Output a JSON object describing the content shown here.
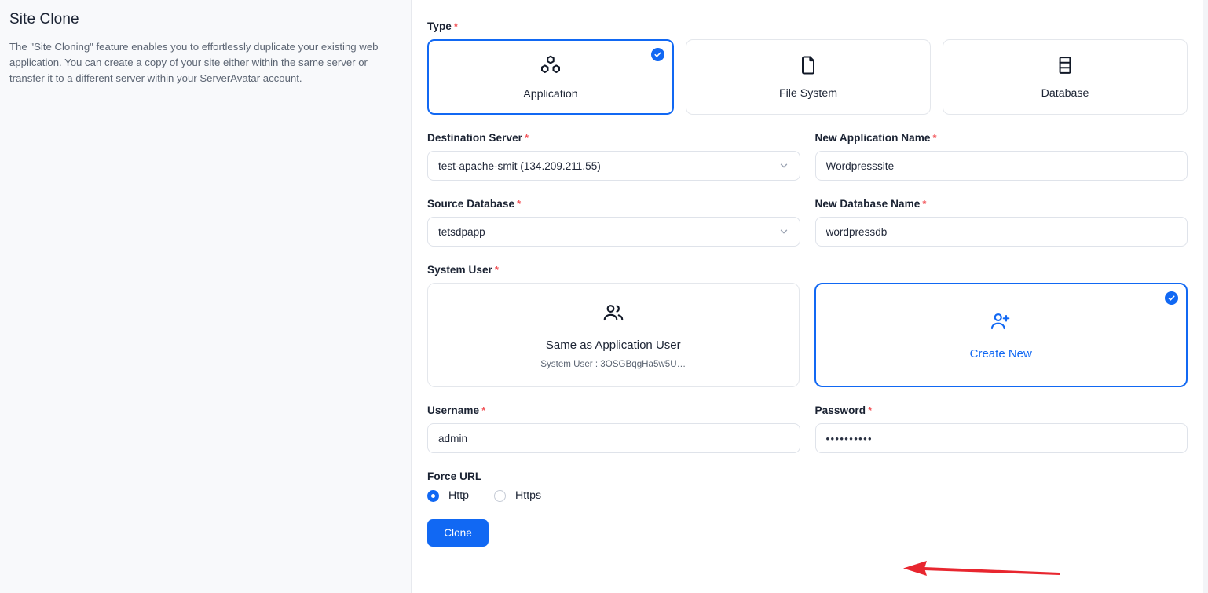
{
  "sidebar": {
    "title": "Site Clone",
    "description": "The \"Site Cloning\" feature enables you to effortlessly duplicate your existing web application. You can create a copy of your site either within the same server or transfer it to a different server within your ServerAvatar account."
  },
  "form": {
    "type": {
      "label": "Type",
      "required": "*",
      "options": [
        {
          "label": "Application",
          "icon": "boxes-icon",
          "selected": true
        },
        {
          "label": "File System",
          "icon": "file-icon",
          "selected": false
        },
        {
          "label": "Database",
          "icon": "database-icon",
          "selected": false
        }
      ]
    },
    "destination_server": {
      "label": "Destination Server",
      "required": "*",
      "value": "test-apache-smit (134.209.211.55)"
    },
    "new_application_name": {
      "label": "New Application Name",
      "required": "*",
      "value": "Wordpresssite"
    },
    "source_database": {
      "label": "Source Database",
      "required": "*",
      "value": "tetsdpapp"
    },
    "new_database_name": {
      "label": "New Database Name",
      "required": "*",
      "value": "wordpressdb"
    },
    "system_user": {
      "label": "System User",
      "required": "*",
      "options": [
        {
          "label": "Same as Application User",
          "sublabel": "System User :  3OSGBqgHa5w5U…",
          "icon": "users-icon",
          "selected": false
        },
        {
          "label": "Create New",
          "sublabel": "",
          "icon": "user-plus-icon",
          "selected": true
        }
      ]
    },
    "username": {
      "label": "Username",
      "required": "*",
      "value": "admin"
    },
    "password": {
      "label": "Password",
      "required": "*",
      "value": "••••••••••"
    },
    "force_url": {
      "label": "Force URL",
      "options": [
        {
          "label": "Http",
          "selected": true
        },
        {
          "label": "Https",
          "selected": false
        }
      ]
    },
    "submit_label": "Clone"
  },
  "annotation": {
    "type": "arrow",
    "direction": "left",
    "color": "#e8262f",
    "points_to": "Clone"
  },
  "colors": {
    "accent": "#1168f3",
    "required": "#f2555a",
    "panel_bg": "#f8f9fb",
    "text": "#1b2333",
    "muted": "#5c6573",
    "border": "#e4e7ec",
    "annotation": "#e8262f"
  }
}
